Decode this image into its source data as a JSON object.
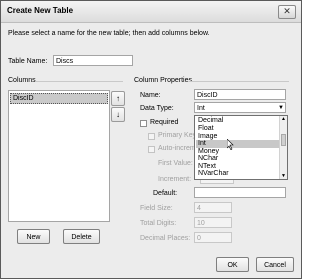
{
  "window": {
    "title": "Create New Table",
    "close_glyph": "✕"
  },
  "instruction": "Please select a name for the new table; then add columns below.",
  "table_name": {
    "label": "Table Name:",
    "value": "Discs"
  },
  "columns": {
    "label": "Columns",
    "items": [
      "DiscID"
    ],
    "up_glyph": "↑",
    "down_glyph": "↓",
    "new_label": "New",
    "delete_label": "Delete"
  },
  "props": {
    "label": "Column Properties",
    "name_label": "Name:",
    "name_value": "DiscID",
    "datatype_label": "Data Type:",
    "datatype_value": "Int",
    "required_label": "Required",
    "primary_key_label": "Primary Key",
    "auto_increment_label": "Auto-increme",
    "first_value_label": "First Value:",
    "increment_label": "Increment:",
    "default_label": "Default:",
    "field_size_label": "Field Size:",
    "field_size_value": "4",
    "total_digits_label": "Total Digits:",
    "total_digits_value": "10",
    "decimal_places_label": "Decimal Places:",
    "decimal_places_value": "0"
  },
  "dropdown": {
    "options": [
      "Decimal",
      "Float",
      "Image",
      "Int",
      "Money",
      "NChar",
      "NText",
      "NVarChar"
    ],
    "selected": "Int"
  },
  "buttons": {
    "ok_label": "OK",
    "cancel_label": "Cancel"
  }
}
